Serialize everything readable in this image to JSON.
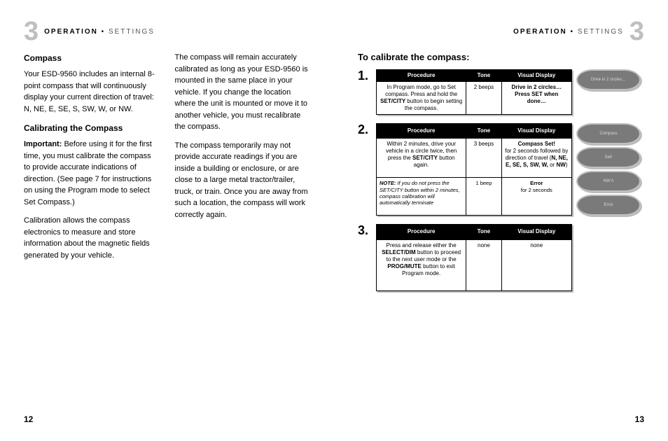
{
  "header": {
    "strong": "OPERATION",
    "bullet": "•",
    "light": "SETTINGS",
    "chapter": "3"
  },
  "left": {
    "pageNum": "12",
    "col1": {
      "h1": "Compass",
      "p1": "Your ESD-9560 includes an internal 8-point compass that will continuously display your current direction of travel: N, NE, E, SE, S, SW, W, or NW.",
      "h2": "Calibrating the Compass",
      "p2a": "Important:",
      "p2b": " Before using it for the first time, you must calibrate the compass to provide accurate indications of direction. (See page 7 for instructions on using the Program mode to select Set Compass.)",
      "p3": "Calibration allows the compass electronics to measure and store information about the magnetic fields generated by your vehicle."
    },
    "col2": {
      "p1": "The compass will remain accurately calibrated as long as your ESD-9560 is mounted in the same place in your vehicle. If you change the location where the unit is mounted or move it to another vehicle, you must recalibrate the compass.",
      "p2": "The compass temporarily may not provide accurate readings if you are inside a building or enclosure, or are close to a large metal tractor/trailer, truck, or train. Once you are away from such a location, the compass will work correctly again."
    }
  },
  "right": {
    "pageNum": "13",
    "title": "To calibrate the compass:",
    "thead": {
      "c1": "Procedure",
      "c2": "Tone",
      "c3": "Visual Display"
    },
    "steps": [
      {
        "num": "1.",
        "rows": [
          {
            "proc_a": "In Program mode, go to Set compass. Press and hold the ",
            "proc_b": "SET/CITY",
            "proc_c": " button to begin setting the compass.",
            "tone": "2 beeps",
            "vis_a": "Drive in 2 circles…",
            "vis_b": "Press SET when done…"
          }
        ],
        "lcds": [
          "Drive in 2 circles…"
        ]
      },
      {
        "num": "2.",
        "rows": [
          {
            "proc_a": "Within 2 minutes, drive your vehicle in a circle twice, then press the ",
            "proc_b": "SET/CITY",
            "proc_c": " button again.",
            "tone": "3 beeps",
            "vis_a": "Compass Set!",
            "vis_b": "for 2 seconds followed by direction of travel (",
            "vis_c": "N, NE, E, SE, S, SW, W,",
            "vis_d": " or ",
            "vis_e": "NW",
            "vis_f": ")"
          }
        ],
        "note": {
          "label": "NOTE:",
          "text": " If you do not press the SET/CITY button within 2 minutes, compass calibration will automatically terminate",
          "tone": "1 beep",
          "vis_a": "Error",
          "vis_b": "for 2 seconds"
        },
        "lcds": [
          "Compass",
          "Set!",
          "NW     h",
          "Error"
        ]
      },
      {
        "num": "3.",
        "rows": [
          {
            "proc_a": "Press and release either the ",
            "proc_b": "SELECT/DIM",
            "proc_c": " button to proceed to the next user mode or the ",
            "proc_d": "PROG/MUTE",
            "proc_e": " button to exit Program mode.",
            "tone": "none",
            "vis": "none"
          }
        ],
        "lcds": []
      }
    ]
  }
}
